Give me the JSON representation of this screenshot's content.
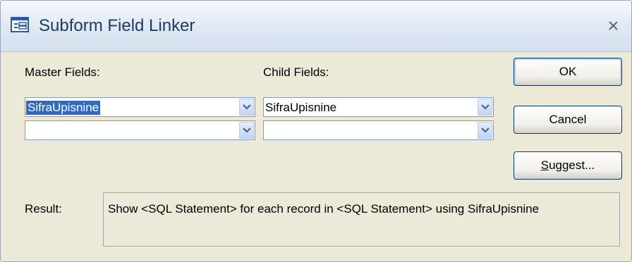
{
  "window": {
    "title": "Subform Field Linker",
    "close_label": "x"
  },
  "labels": {
    "master": "Master Fields:",
    "child": "Child Fields:",
    "result": "Result:"
  },
  "master_fields": [
    "SifraUpisnine",
    ""
  ],
  "child_fields": [
    "SifraUpisnine",
    ""
  ],
  "buttons": {
    "ok": "OK",
    "cancel": "Cancel",
    "suggest_prefix": "S",
    "suggest_rest": "uggest..."
  },
  "result_text": "Show <SQL Statement> for each record in <SQL Statement> using SifraUpisnine",
  "colors": {
    "selection": "#316ac5",
    "dialog_bg": "#ece9d8",
    "title_text": "#1f3b66"
  },
  "icons": {
    "app": "form-icon",
    "close": "close-icon",
    "dropdown": "chevron-down-icon"
  }
}
